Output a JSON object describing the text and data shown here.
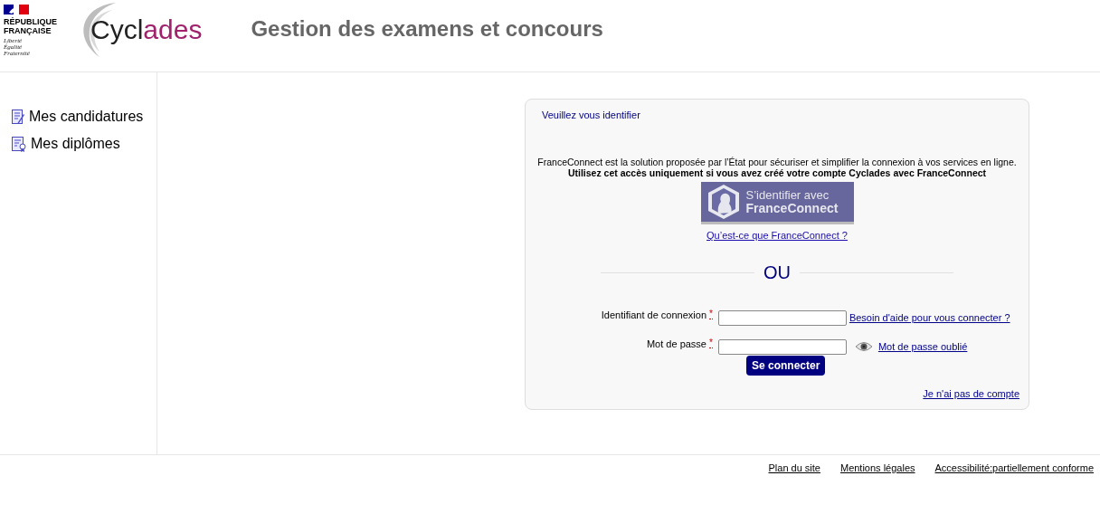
{
  "header": {
    "republic": [
      "RÉPUBLIQUE",
      "FRANÇAISE"
    ],
    "motto": [
      "Liberté",
      "Égalité",
      "Fraternité"
    ],
    "brand_parts": [
      "Cycl",
      "ades"
    ],
    "title": "Gestion des examens et concours"
  },
  "sidebar": {
    "items": [
      {
        "label": "Mes candidatures",
        "kind": "form"
      },
      {
        "label": "Mes diplômes",
        "kind": "diploma"
      }
    ]
  },
  "login": {
    "heading": "Veuillez vous identifier",
    "intro": "FranceConnect est la solution proposée par l’État pour sécuriser et simplifier la connexion à vos services en ligne.",
    "warning": "Utilisez cet accès uniquement si vous avez créé votre compte Cyclades avec FranceConnect",
    "fc_button": [
      "S’identifier avec",
      "FranceConnect"
    ],
    "fc_link": "Qu’est-ce que FranceConnect ?",
    "separator": "OU",
    "fields": [
      {
        "label": "Identifiant de connexion",
        "required_mark": "*",
        "kind": "text",
        "link": "Besoin d'aide pour vous connecter ?"
      },
      {
        "label": "Mot de passe",
        "required_mark": "*",
        "kind": "password",
        "link": "Mot de passe oublié"
      }
    ],
    "submit": "Se connecter",
    "no_account": "Je n'ai pas de compte"
  },
  "footer": {
    "links": [
      "Plan du site",
      "Mentions légales",
      "Accessibilité:partiellement conforme"
    ]
  }
}
